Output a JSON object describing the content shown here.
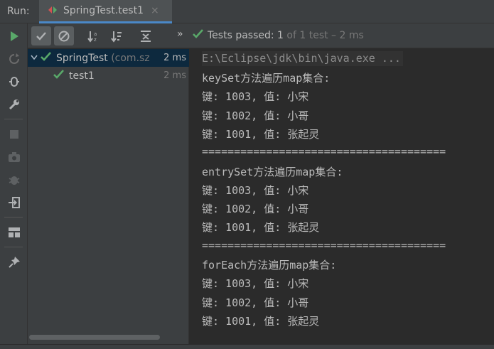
{
  "titlebar": {
    "run_label": "Run:",
    "tab_label": "SpringTest.test1",
    "close_glyph": "×"
  },
  "toolbar": {
    "tests_passed": "Tests passed:",
    "passed_count": "1",
    "of_total": "of 1 test – 2 ms",
    "more_glyph": "»"
  },
  "tree": {
    "root": {
      "name": "SpringTest",
      "package": "(com.sz",
      "time": "2 ms",
      "status": "passed"
    },
    "child": {
      "name": "test1",
      "time": "2 ms",
      "status": "passed"
    }
  },
  "console": {
    "command": "E:\\Eclipse\\jdk\\bin\\java.exe ...",
    "lines": [
      "keySet方法遍历map集合:",
      "键: 1003, 值: 小宋",
      "键: 1002, 值: 小哥",
      "键: 1001, 值: 张起灵",
      "======================================",
      "entrySet方法遍历map集合:",
      "键: 1003, 值: 小宋",
      "键: 1002, 值: 小哥",
      "键: 1001, 值: 张起灵",
      "======================================",
      "forEach方法遍历map集合:",
      "键: 1003, 值: 小宋",
      "键: 1002, 值: 小哥",
      "键: 1001, 值: 张起灵"
    ]
  },
  "icons": {
    "rerun": "play-icon",
    "rerun_failed": "rerun-failed-icon",
    "debug": "debug-icon",
    "settings": "wrench-icon",
    "stop": "stop-icon",
    "screenshot": "camera-icon",
    "bug": "bug-icon",
    "login": "exit-icon",
    "layout": "layout-icon",
    "pin": "pin-icon",
    "show_passed": "check-icon",
    "show_ignored": "ignored-icon",
    "sort_alpha": "sort-alpha-icon",
    "sort_duration": "sort-duration-icon",
    "collapse": "collapse-icon"
  },
  "colors": {
    "accent_green": "#59a869",
    "selection": "#0d293e",
    "tab_underline": "#4a88c7"
  }
}
